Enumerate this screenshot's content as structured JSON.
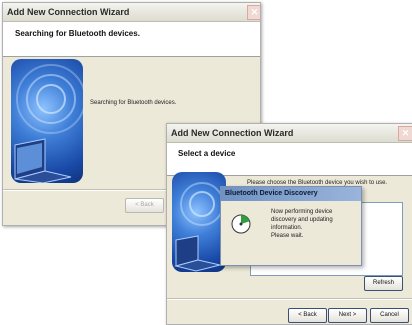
{
  "window1": {
    "title": "Add New Connection Wizard",
    "header_title": "Searching for Bluetooth devices.",
    "body_text": "Searching for Bluetooth devices.",
    "back_label": "< Back"
  },
  "window2": {
    "title": "Add New Connection Wizard",
    "header_title": "Select a device",
    "instruction": "Please choose the Bluetooth device you wish to use.",
    "refresh_label": "Refresh",
    "back_label": "< Back",
    "next_label": "Next >",
    "cancel_label": "Cancel"
  },
  "popup": {
    "title": "Bluetooth Device Discovery",
    "message_line1": "Now performing device",
    "message_line2": "discovery and updating",
    "message_line3": "information.",
    "message_line4": "Please wait."
  },
  "colors": {
    "popup_title_start": "#6f92c4",
    "popup_title_end": "#9ab4db",
    "art_blue": "#2f6fd0"
  }
}
